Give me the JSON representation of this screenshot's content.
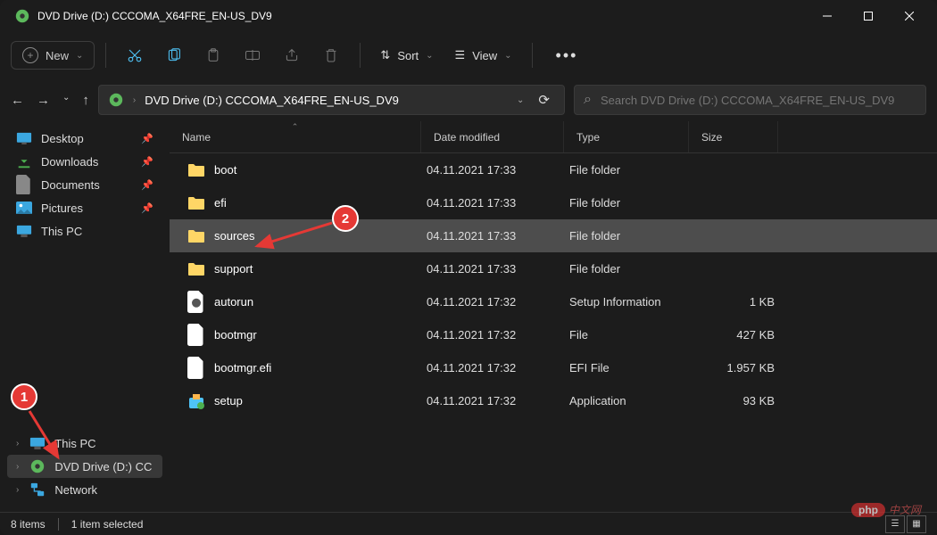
{
  "window": {
    "title": "DVD Drive (D:) CCCOMA_X64FRE_EN-US_DV9"
  },
  "toolbar": {
    "new_label": "New",
    "sort_label": "Sort",
    "view_label": "View"
  },
  "address_bar": {
    "path": "DVD Drive (D:) CCCOMA_X64FRE_EN-US_DV9"
  },
  "search": {
    "placeholder": "Search DVD Drive (D:) CCCOMA_X64FRE_EN-US_DV9"
  },
  "sidebar": {
    "quick": [
      {
        "icon": "desktop",
        "label": "Desktop",
        "pinned": true
      },
      {
        "icon": "downloads",
        "label": "Downloads",
        "pinned": true
      },
      {
        "icon": "documents",
        "label": "Documents",
        "pinned": true
      },
      {
        "icon": "pictures",
        "label": "Pictures",
        "pinned": true
      },
      {
        "icon": "thispc",
        "label": "This PC",
        "pinned": false
      }
    ],
    "tree": [
      {
        "icon": "thispc",
        "label": "This PC"
      },
      {
        "icon": "dvd",
        "label": "DVD Drive (D:) CC",
        "selected": true
      },
      {
        "icon": "network",
        "label": "Network"
      }
    ]
  },
  "columns": {
    "name": "Name",
    "date": "Date modified",
    "type": "Type",
    "size": "Size"
  },
  "files": [
    {
      "icon": "folder",
      "name": "boot",
      "date": "04.11.2021 17:33",
      "type": "File folder",
      "size": ""
    },
    {
      "icon": "folder",
      "name": "efi",
      "date": "04.11.2021 17:33",
      "type": "File folder",
      "size": ""
    },
    {
      "icon": "folder",
      "name": "sources",
      "date": "04.11.2021 17:33",
      "type": "File folder",
      "size": "",
      "selected": true
    },
    {
      "icon": "folder",
      "name": "support",
      "date": "04.11.2021 17:33",
      "type": "File folder",
      "size": ""
    },
    {
      "icon": "inf",
      "name": "autorun",
      "date": "04.11.2021 17:32",
      "type": "Setup Information",
      "size": "1 KB"
    },
    {
      "icon": "file",
      "name": "bootmgr",
      "date": "04.11.2021 17:32",
      "type": "File",
      "size": "427 KB"
    },
    {
      "icon": "file",
      "name": "bootmgr.efi",
      "date": "04.11.2021 17:32",
      "type": "EFI File",
      "size": "1.957 KB"
    },
    {
      "icon": "setup",
      "name": "setup",
      "date": "04.11.2021 17:32",
      "type": "Application",
      "size": "93 KB"
    }
  ],
  "status": {
    "count": "8 items",
    "selected": "1 item selected"
  },
  "annotations": {
    "b1": "1",
    "b2": "2"
  },
  "watermark": {
    "badge": "php",
    "text": "中文网"
  }
}
